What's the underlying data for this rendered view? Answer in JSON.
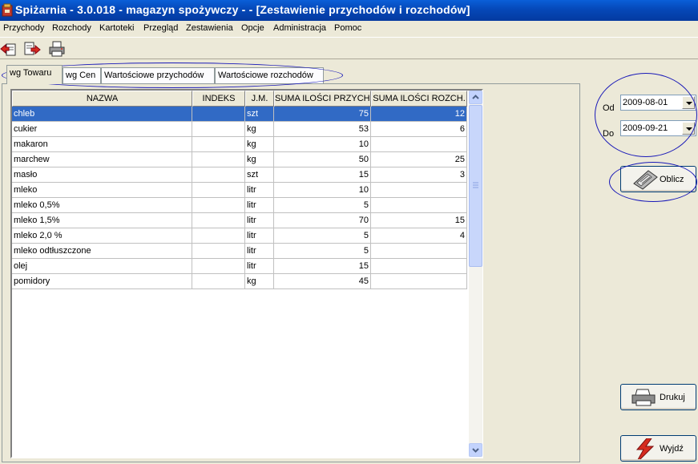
{
  "window": {
    "title": "Spiżarnia - 3.0.018 - magazyn spożywczy -  - [Zestawienie przychodów i rozchodów]"
  },
  "menu": [
    "Przychody",
    "Rozchody",
    "Kartoteki",
    "Przegląd",
    "Zestawienia",
    "Opcje",
    "Administracja",
    "Pomoc"
  ],
  "toolbar_icons": [
    "import-icon",
    "export-icon",
    "print-icon"
  ],
  "tabs": [
    "wg Towaru",
    "wg Cen",
    "Wartościowe przychodów",
    "Wartościowe rozchodów"
  ],
  "active_tab": "wg Towaru",
  "table": {
    "columns": [
      "NAZWA",
      "INDEKS",
      "J.M.",
      "SUMA ILOŚCI PRZYCH.",
      "SUMA ILOŚCI ROZCH."
    ],
    "rows": [
      [
        "chleb",
        "",
        "szt",
        "75",
        "12"
      ],
      [
        "cukier",
        "",
        "kg",
        "53",
        "6"
      ],
      [
        "makaron",
        "",
        "kg",
        "10",
        ""
      ],
      [
        "marchew",
        "",
        "kg",
        "50",
        "25"
      ],
      [
        "masło",
        "",
        "szt",
        "15",
        "3"
      ],
      [
        "mleko",
        "",
        "litr",
        "10",
        ""
      ],
      [
        "mleko 0,5%",
        "",
        "litr",
        "5",
        ""
      ],
      [
        "mleko 1,5%",
        "",
        "litr",
        "70",
        "15"
      ],
      [
        "mleko 2,0 %",
        "",
        "litr",
        "5",
        "4"
      ],
      [
        "mleko odtłuszczone",
        "",
        "litr",
        "5",
        ""
      ],
      [
        "olej",
        "",
        "litr",
        "15",
        ""
      ],
      [
        "pomidory",
        "",
        "kg",
        "45",
        ""
      ]
    ],
    "selected_row": 0
  },
  "filters": {
    "from_label": "Od",
    "from_value": "2009-08-01",
    "to_label": "Do",
    "to_value": "2009-09-21"
  },
  "buttons": {
    "calculate": "Oblicz",
    "print": "Drukuj",
    "exit": "Wyjdź"
  },
  "colors": {
    "selection": "#316ac5",
    "annotation": "#1a1ab8",
    "titlebar": "#0548b8"
  }
}
